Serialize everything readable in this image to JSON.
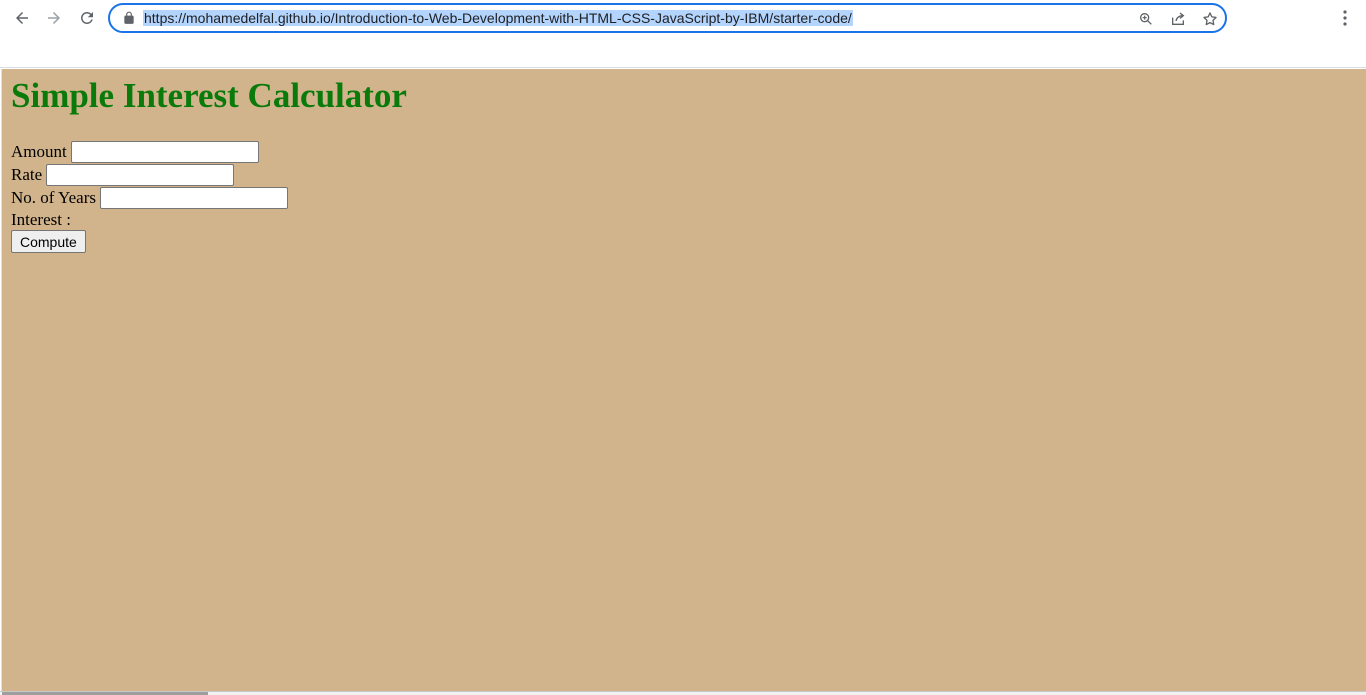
{
  "browser": {
    "url": "https://mohamedelfal.github.io/Introduction-to-Web-Development-with-HTML-CSS-JavaScript-by-IBM/starter-code/",
    "icons": {
      "back": "back-arrow-icon",
      "forward": "forward-arrow-icon",
      "reload": "reload-icon",
      "lock": "lock-icon",
      "zoom": "zoom-icon",
      "share": "share-icon",
      "bookmark": "star-icon",
      "menu": "kebab-menu-icon"
    },
    "colors": {
      "omnibox_border": "#1a73e8",
      "url_selection": "#b3d4fc"
    }
  },
  "page": {
    "background": "#d2b48c",
    "heading": "Simple Interest Calculator",
    "heading_color": "#0a7a0a",
    "form": {
      "amount_label": "Amount",
      "rate_label": "Rate",
      "years_label": "No. of Years",
      "interest_label": "Interest :",
      "amount_value": "",
      "rate_value": "",
      "years_value": ""
    },
    "compute_label": "Compute"
  }
}
